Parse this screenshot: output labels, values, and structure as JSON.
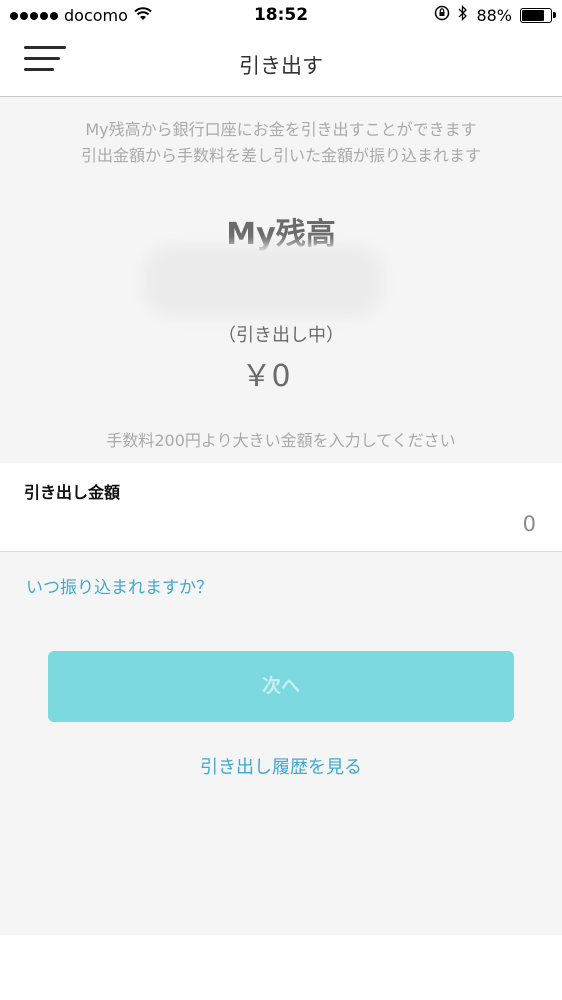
{
  "status_bar": {
    "carrier": "docomo",
    "time": "18:52",
    "battery_pct": "88%",
    "icons": [
      "signal-dots-icon",
      "wifi-icon",
      "orientation-lock-icon",
      "bluetooth-icon",
      "battery-icon"
    ]
  },
  "nav": {
    "title": "引き出す",
    "menu_icon": "hamburger-menu-icon"
  },
  "intro": {
    "line1": "My残高から銀行口座にお金を引き出すことができます",
    "line2": "引出金額から手数料を差し引いた金額が振り込まれます"
  },
  "balance": {
    "label": "My残高"
  },
  "pending": {
    "label": "（引き出し中）",
    "value": "￥0"
  },
  "fee_note": "手数料200円より大きい金額を入力してください",
  "amount_field": {
    "label": "引き出し金額",
    "placeholder": "0"
  },
  "when_link": "いつ振り込まれますか？",
  "next_button": "次へ",
  "history_link": "引き出し履歴を見る",
  "colors": {
    "accent": "#3fa9d1",
    "button_bg": "#7cd9df",
    "content_bg": "#f5f5f5"
  }
}
